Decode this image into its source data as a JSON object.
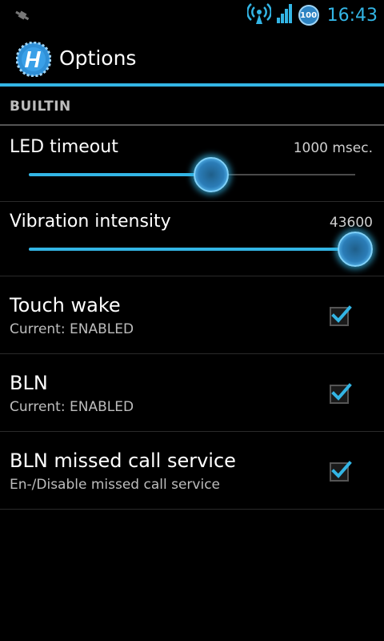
{
  "status_bar": {
    "time": "16:43",
    "battery_level": "100",
    "icons": [
      "notification-icon",
      "wifi-hotspot-icon",
      "signal-icon",
      "battery-icon"
    ]
  },
  "action_bar": {
    "title": "Options",
    "app_icon": "app-icon"
  },
  "section": {
    "title": "BUILTIN"
  },
  "sliders": [
    {
      "title": "LED timeout",
      "value": "1000 msec.",
      "level": 0.56
    },
    {
      "title": "Vibration intensity",
      "value": "43600",
      "level": 1.0
    }
  ],
  "checkboxes": [
    {
      "title": "Touch wake",
      "subtitle": "Current: ENABLED",
      "checked": true
    },
    {
      "title": "BLN",
      "subtitle": "Current: ENABLED",
      "checked": true
    },
    {
      "title": "BLN missed call service",
      "subtitle": "En-/Disable missed call service",
      "checked": true
    }
  ],
  "colors": {
    "accent": "#33b5e5",
    "background": "#000000"
  }
}
